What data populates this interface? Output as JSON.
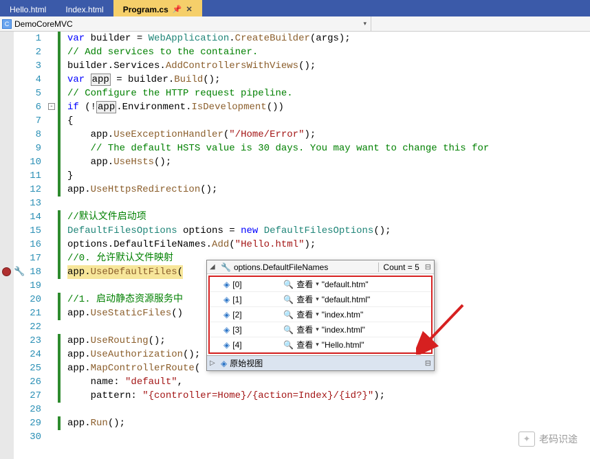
{
  "tabs": {
    "items": [
      {
        "label": "Hello.html",
        "active": false
      },
      {
        "label": "Index.html",
        "active": false
      },
      {
        "label": "Program.cs",
        "active": true
      }
    ]
  },
  "nav": {
    "project": "DemoCoreMVC"
  },
  "gutter": {
    "start": 1,
    "end": 30,
    "breakpoint_line": 18,
    "fold_line": 6
  },
  "code": {
    "l1": {
      "pre": "var",
      "t1": " builder = ",
      "type": "WebApplication",
      "dot": ".",
      "m": "CreateBuilder",
      "tail": "(args);"
    },
    "l2": "// Add services to the container.",
    "l3": {
      "a": "builder.Services.",
      "m": "AddControllersWithViews",
      "b": "();"
    },
    "l4": {
      "kw": "var",
      "sp": " ",
      "box": "app",
      "rest": " = builder.",
      "m": "Build",
      "tail": "();"
    },
    "l5": "// Configure the HTTP request pipeline.",
    "l6": {
      "kw": "if",
      "a": " (!",
      "box": "app",
      "b": ".Environment.",
      "m": "IsDevelopment",
      "c": "())"
    },
    "l7": "{",
    "l8": {
      "indent": "    ",
      "a": "app.",
      "m": "UseExceptionHandler",
      "b": "(",
      "s": "\"/Home/Error\"",
      "c": ");"
    },
    "l9": "    // The default HSTS value is 30 days. You may want to change this for",
    "l10": {
      "indent": "    ",
      "a": "app.",
      "m": "UseHsts",
      "b": "();"
    },
    "l11": "}",
    "l12": {
      "a": "app.",
      "m": "UseHttpsRedirection",
      "b": "();"
    },
    "l14": "//默认文件启动项",
    "l15": {
      "type1": "DefaultFilesOptions",
      "mid": " options = ",
      "kw": "new",
      "sp": " ",
      "type2": "DefaultFilesOptions",
      "tail": "();"
    },
    "l16": {
      "a": "options.DefaultFileNames.",
      "m": "Add",
      "b": "(",
      "s": "\"Hello.html\"",
      "c": ");"
    },
    "l17": "//0. 允许默认文件映射",
    "l18": {
      "a": "app.",
      "m": "UseDefaultFiles",
      "b": "("
    },
    "l20": "//1. 启动静态资源服务中",
    "l21": {
      "a": "app.",
      "m": "UseStaticFiles",
      "b": "()"
    },
    "l23": {
      "a": "app.",
      "m": "UseRouting",
      "b": "();"
    },
    "l24": {
      "a": "app.",
      "m": "UseAuthorization",
      "b": "();"
    },
    "l25": {
      "a": "app.",
      "m": "MapControllerRoute",
      "b": "("
    },
    "l26": {
      "indent": "    ",
      "a": "name: ",
      "s": "\"default\"",
      "b": ","
    },
    "l27": {
      "indent": "    ",
      "a": "pattern: ",
      "s": "\"{controller=Home}/{action=Index}/{id?}\"",
      "b": ");"
    },
    "l29": {
      "a": "app.",
      "m": "Run",
      "b": "();"
    }
  },
  "watch": {
    "expr": "options.DefaultFileNames",
    "count_label": "Count = 5",
    "view_label": "查看",
    "raw_label": "原始视图",
    "items": [
      {
        "idx": "[0]",
        "val": "\"default.htm\""
      },
      {
        "idx": "[1]",
        "val": "\"default.html\""
      },
      {
        "idx": "[2]",
        "val": "\"index.htm\""
      },
      {
        "idx": "[3]",
        "val": "\"index.html\""
      },
      {
        "idx": "[4]",
        "val": "\"Hello.html\""
      }
    ]
  },
  "watermark": {
    "text": "老码识途"
  }
}
